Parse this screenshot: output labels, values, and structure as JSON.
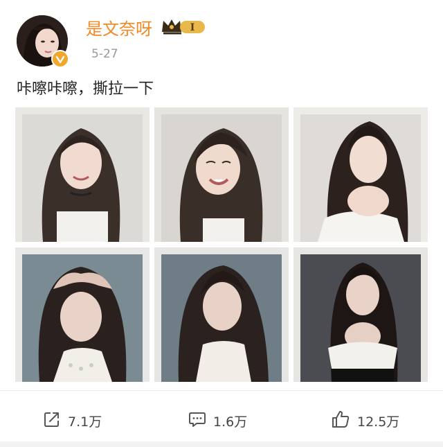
{
  "post": {
    "username": "是文奈呀",
    "level_badge": "I",
    "date": "5-27",
    "text": "咔嚓咔嚓，撕拉一下",
    "photos": [
      {
        "name": "photo-1"
      },
      {
        "name": "photo-2"
      },
      {
        "name": "photo-3"
      },
      {
        "name": "photo-4"
      },
      {
        "name": "photo-5"
      },
      {
        "name": "photo-6"
      }
    ]
  },
  "actions": {
    "share_count": "7.1万",
    "comment_count": "1.6万",
    "like_count": "12.5万"
  },
  "colors": {
    "username": "#f08a24",
    "badge_gold": "#e8b84a",
    "verified": "#f0a72b"
  },
  "icons": [
    "verified-icon",
    "crown-badge-icon",
    "share-icon",
    "comment-icon",
    "like-icon"
  ]
}
